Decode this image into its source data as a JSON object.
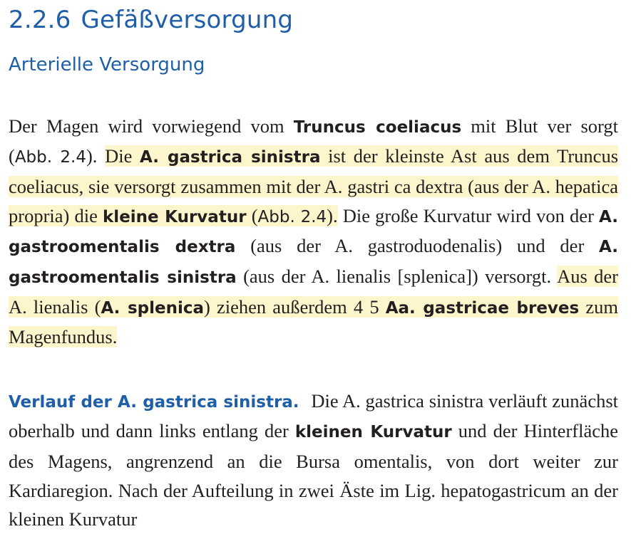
{
  "section": {
    "number": "2.2.6",
    "title": "Gefäßversorgung"
  },
  "subsection": {
    "title": "Arterielle Versorgung"
  },
  "paragraph1": {
    "s01": "Der Magen wird vorwiegend vom ",
    "s02": "Truncus coeliacus",
    "s03": " mit Blut ver sorgt (",
    "s04": "Abb. 2.4",
    "s05": "). ",
    "s06": "Die ",
    "s07": "A. gastrica sinistra",
    "s08": " ist der kleinste Ast aus dem Truncus coeliacus, sie versorgt zusammen mit der A. gastri ca dextra (aus der A. hepatica propria) die ",
    "s09": "kleine Kurvatur",
    "s10": " (",
    "s11": "Abb. 2.4",
    "s12": ").",
    "s13": " Die große Kurvatur wird von der ",
    "s14": "A. gastroomentalis dextra",
    "s15": " (aus der A. gastroduodenalis) und der ",
    "s16": "A. gastroomentalis sinistra",
    "s17": " (aus der A. lienalis [splenica]) versorgt. ",
    "s18": "Aus der A. lienalis (",
    "s19": "A. splenica",
    "s20": ") ziehen außerdem 4 5 ",
    "s21": "Aa. gastricae breves",
    "s22": " zum Magenfundus."
  },
  "paragraph2": {
    "runin": "Verlauf der A. gastrica sinistra.",
    "t1": "Die A. gastrica sinistra verläuft zunächst oberhalb und dann links entlang der ",
    "t2": "kleinen Kurvatur",
    "t3": " und der Hinterfläche des Magens, angrenzend an die Bursa omentalis, von dort weiter zur Kardiaregion. Nach der Aufteilung in zwei Äste im Lig. hepatogastricum an der kleinen Kurvatur"
  },
  "colors": {
    "heading": "#1f5ea8",
    "highlight": "#fdf6cc",
    "text": "#231f20"
  }
}
